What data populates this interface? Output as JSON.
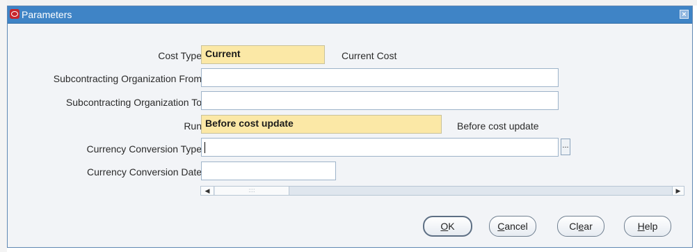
{
  "window": {
    "title": "Parameters",
    "close_symbol": "×"
  },
  "fields": {
    "cost_type": {
      "label": "Cost Type",
      "value": "Current",
      "description": "Current Cost"
    },
    "sub_org_from": {
      "label": "Subcontracting Organization From",
      "value": ""
    },
    "sub_org_to": {
      "label": "Subcontracting Organization To",
      "value": ""
    },
    "run": {
      "label": "Run",
      "value": "Before cost update",
      "description": "Before cost update"
    },
    "currency_conversion_type": {
      "label": "Currency Conversion Type",
      "value": "",
      "lov_symbol": "..."
    },
    "currency_conversion_date": {
      "label": "Currency Conversion Date",
      "value": ""
    }
  },
  "scrollbar": {
    "left_arrow": "◀",
    "thumb_grip": "::::",
    "right_arrow": "▶"
  },
  "buttons": {
    "ok": {
      "mnemonic": "O",
      "rest": "K"
    },
    "cancel": {
      "mnemonic": "C",
      "rest": "ancel"
    },
    "clear": {
      "pre": "Cl",
      "mnemonic": "e",
      "rest": "ar"
    },
    "help": {
      "mnemonic": "H",
      "rest": "elp"
    }
  },
  "colors": {
    "titlebar": "#3f84c6",
    "required_field": "#fbe8a6",
    "dialog_bg": "#f2f4f7"
  }
}
